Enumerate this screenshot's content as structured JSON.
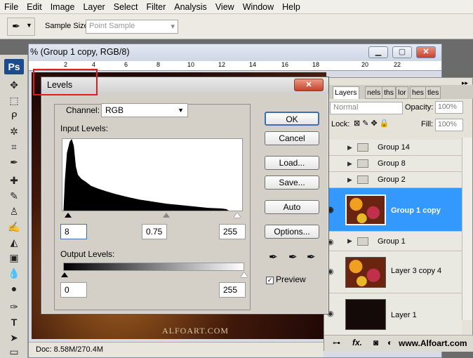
{
  "menubar": [
    "File",
    "Edit",
    "Image",
    "Layer",
    "Select",
    "Filter",
    "Analysis",
    "View",
    "Window",
    "Help"
  ],
  "options": {
    "sample_size_label": "Sample Size:",
    "sample_size_value": "Point Sample"
  },
  "toolbox": {
    "logo": "Ps"
  },
  "document": {
    "title": "% (Group 1 copy, RGB/8)",
    "ruler": [
      "2",
      "4",
      "6",
      "8",
      "10",
      "12",
      "14",
      "16",
      "18",
      "20",
      "22"
    ],
    "min": "▁",
    "restore": "▢",
    "close": "✕",
    "watermark": "ALFOART.COM",
    "status": "Doc: 8.58M/270.4M"
  },
  "levels": {
    "title": "Levels",
    "close": "✕",
    "channel_label": "Channel:",
    "channel_value": "RGB",
    "input_label": "Input Levels:",
    "input_black": "8",
    "input_gamma": "0.75",
    "input_white": "255",
    "output_label": "Output Levels:",
    "output_black": "0",
    "output_white": "255",
    "buttons": {
      "ok": "OK",
      "cancel": "Cancel",
      "load": "Load...",
      "save": "Save...",
      "auto": "Auto",
      "options": "Options..."
    },
    "preview_label": "Preview",
    "preview_checked": true
  },
  "layers": {
    "tabs": [
      "Layers",
      "nels",
      "ths",
      "lor",
      "hes",
      "tles"
    ],
    "blend_mode": "Normal",
    "opacity_label": "Opacity:",
    "opacity": "100%",
    "lock_label": "Lock:",
    "fill_label": "Fill:",
    "fill": "100%",
    "items": [
      {
        "name": "Group 14",
        "type": "group"
      },
      {
        "name": "Group 8",
        "type": "group"
      },
      {
        "name": "Group 2",
        "type": "group"
      },
      {
        "name": "Group 1 copy",
        "type": "layer",
        "selected": true
      },
      {
        "name": "Group 1",
        "type": "group"
      },
      {
        "name": "Layer 3 copy 4",
        "type": "layer"
      },
      {
        "name": "Layer 1",
        "type": "layer"
      }
    ],
    "bottom_fx": "fx."
  },
  "site_watermark": "www.Alfoart.com"
}
